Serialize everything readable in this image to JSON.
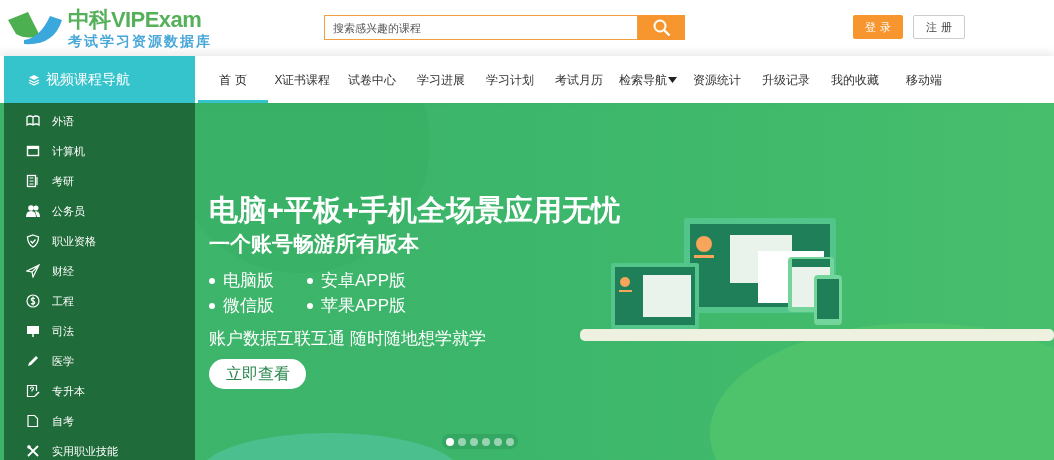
{
  "logo": {
    "title": "中科VIPExam",
    "subtitle": "考试学习资源数据库"
  },
  "search": {
    "placeholder": "搜索感兴趣的课程"
  },
  "auth_buttons": [
    {
      "label": "登 录",
      "kind": "primary"
    },
    {
      "label": "注 册",
      "kind": "secondary"
    }
  ],
  "sidebar": {
    "title": "视频课程导航",
    "items": [
      {
        "label": "外语"
      },
      {
        "label": "计算机"
      },
      {
        "label": "考研"
      },
      {
        "label": "公务员"
      },
      {
        "label": "职业资格"
      },
      {
        "label": "财经"
      },
      {
        "label": "工程"
      },
      {
        "label": "司法"
      },
      {
        "label": "医学"
      },
      {
        "label": "专升本"
      },
      {
        "label": "自考"
      },
      {
        "label": "实用职业技能"
      }
    ]
  },
  "nav": [
    {
      "label": "首 页",
      "selected": true,
      "dropdown": false
    },
    {
      "label": "X证书课程",
      "selected": false,
      "dropdown": false
    },
    {
      "label": "试卷中心",
      "selected": false,
      "dropdown": false
    },
    {
      "label": "学习进展",
      "selected": false,
      "dropdown": false
    },
    {
      "label": "学习计划",
      "selected": false,
      "dropdown": false
    },
    {
      "label": "考试月历",
      "selected": false,
      "dropdown": false
    },
    {
      "label": "检索导航",
      "selected": false,
      "dropdown": true
    },
    {
      "label": "资源统计",
      "selected": false,
      "dropdown": false
    },
    {
      "label": "升级记录",
      "selected": false,
      "dropdown": false
    },
    {
      "label": "我的收藏",
      "selected": false,
      "dropdown": false
    },
    {
      "label": "移动端",
      "selected": false,
      "dropdown": false
    }
  ],
  "banner": {
    "headline": "电脑+平板+手机全场景应用无忧",
    "subheadline": "一个账号畅游所有版本",
    "features": [
      "电脑版",
      "安卓APP版",
      "微信版",
      "苹果APP版"
    ],
    "tagline": "账户数据互联互通 随时随地想学就学",
    "button": "立即查看",
    "slides": [
      {
        "selected": true
      },
      {
        "selected": false
      },
      {
        "selected": false
      },
      {
        "selected": false
      },
      {
        "selected": false
      },
      {
        "selected": false
      }
    ]
  }
}
